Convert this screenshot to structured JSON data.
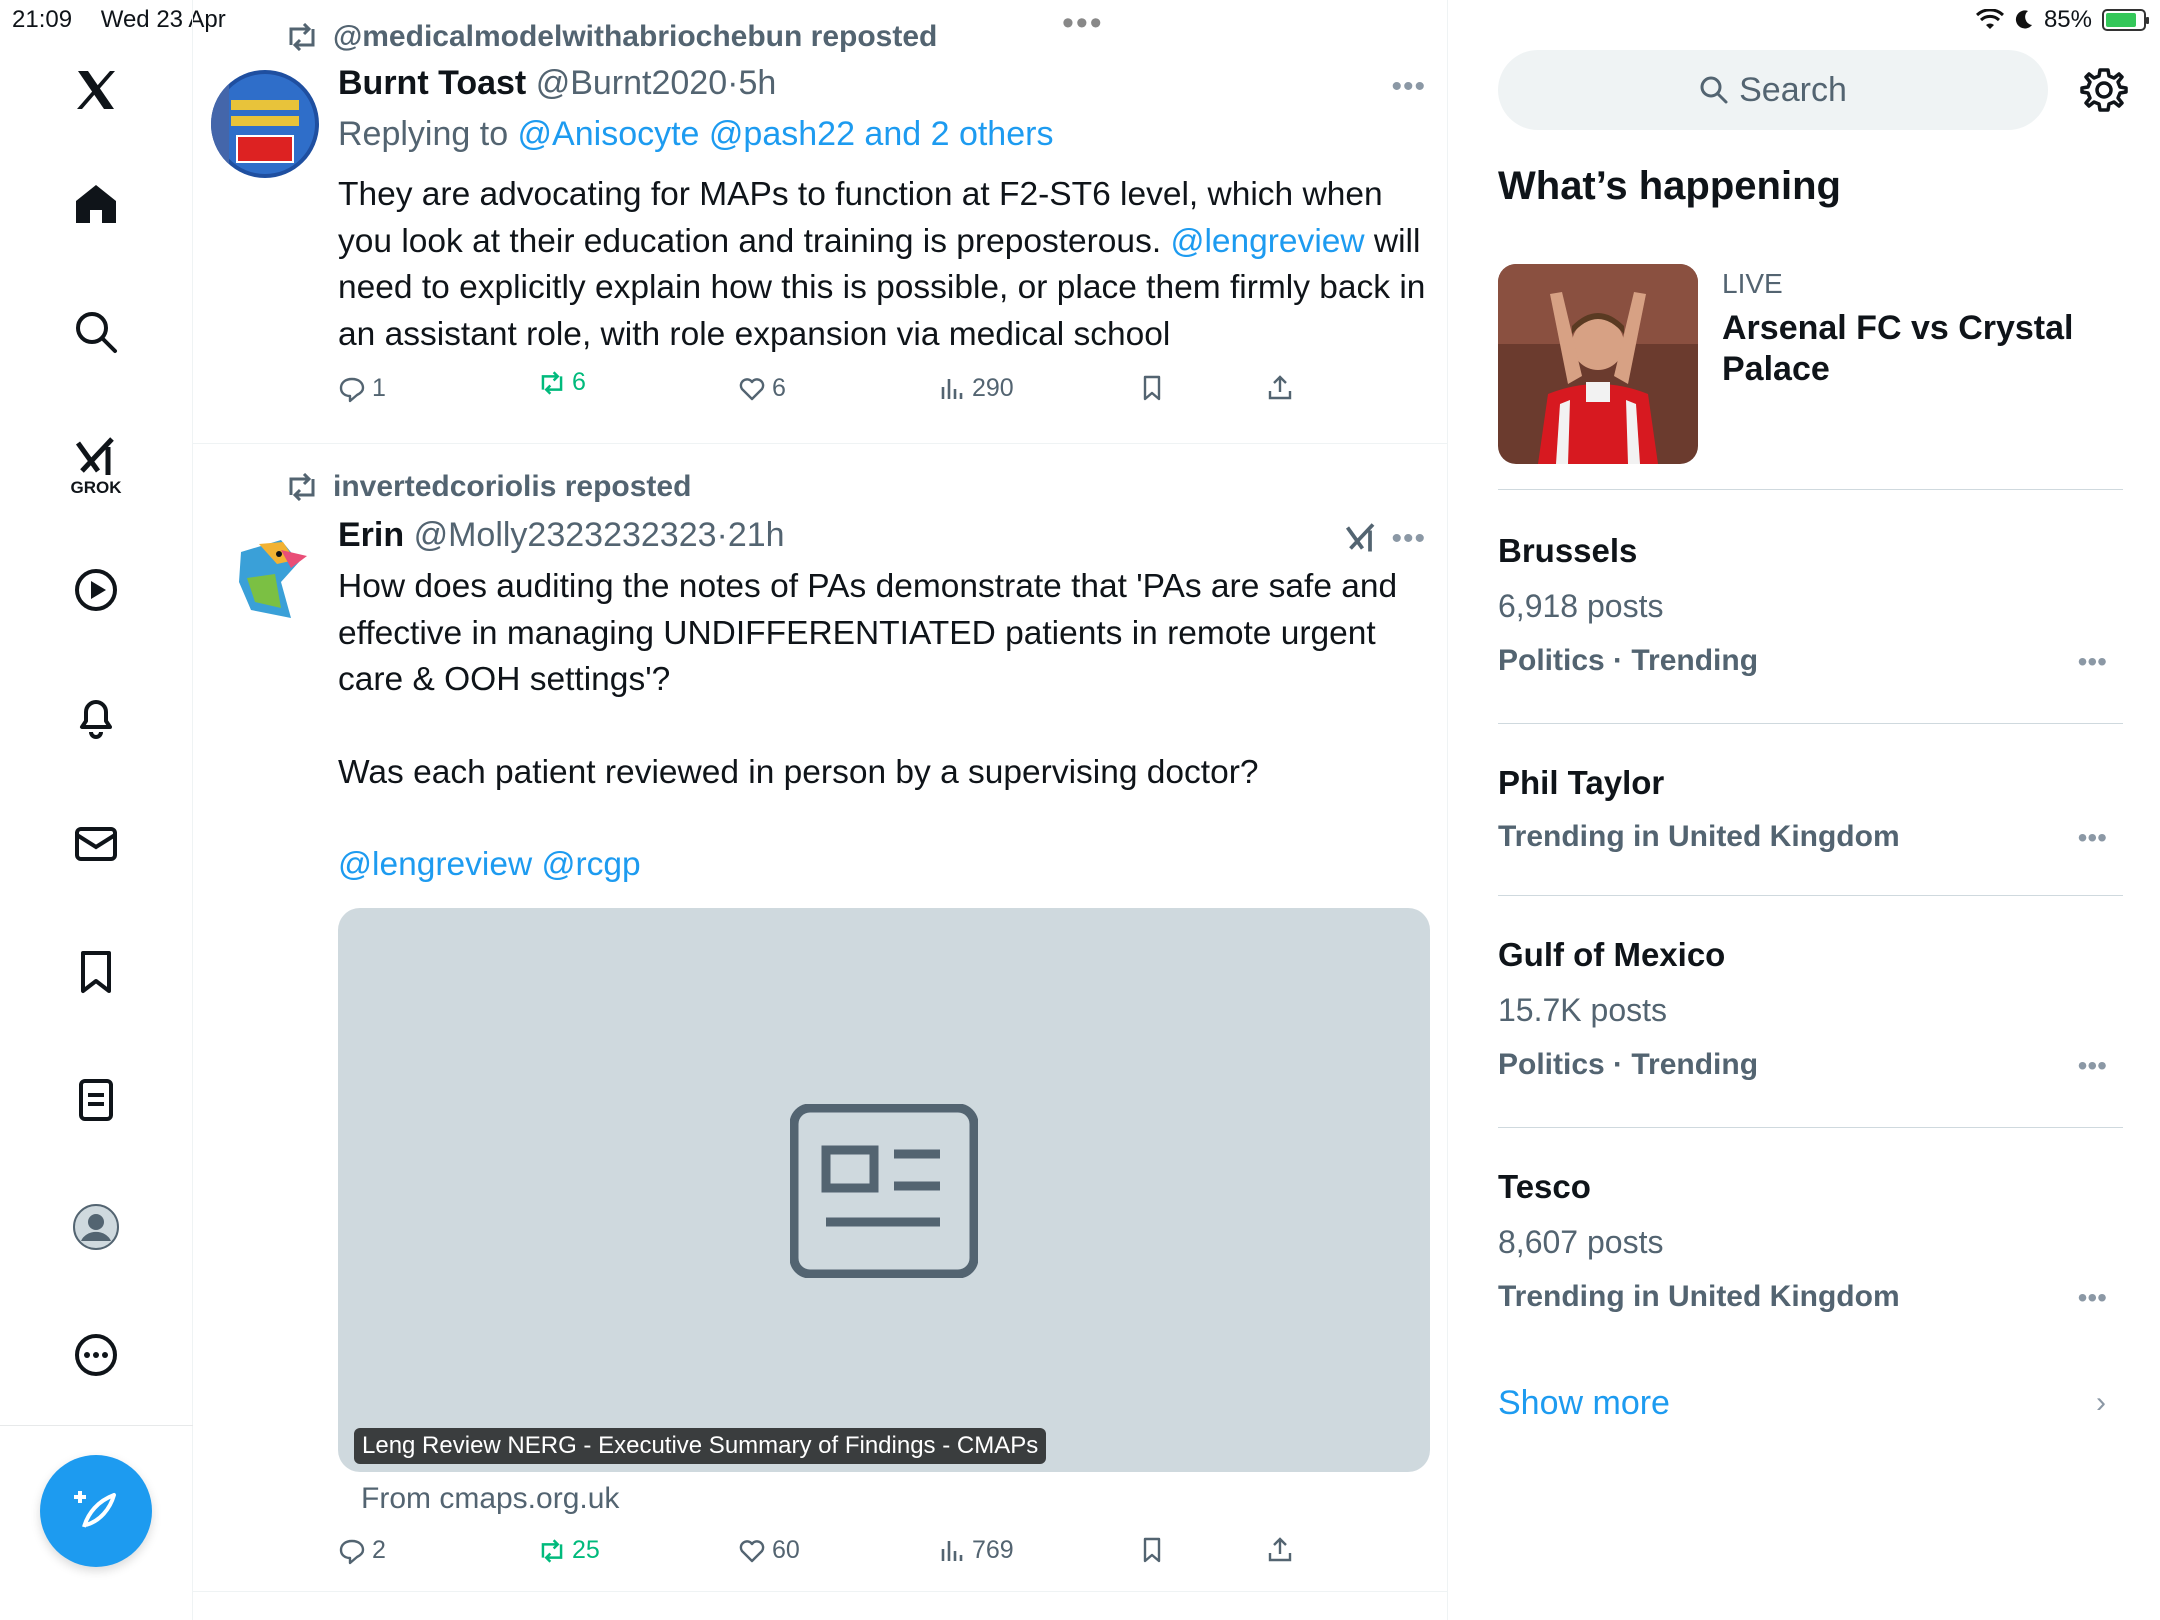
{
  "status_bar": {
    "time": "21:09",
    "date": "Wed 23 Apr",
    "battery": "85%"
  },
  "nav": {
    "grok_label": "GROK"
  },
  "posts": [
    {
      "reposted_by": "@medicalmodelwithabriochebun reposted",
      "name": "Burnt Toast",
      "handle": "@Burnt2020",
      "dot": "·",
      "time": "5h",
      "reply_prefix": "Replying to ",
      "reply_to": "@Anisocyte @pash22 and 2 others",
      "text_1": "They are advocating for MAPs to function at F2-ST6 level, which when you look at their education and training is preposterous. ",
      "mention": "@lengreview",
      "text_2": " will need to explicitly explain how this is possible, or place them firmly back in an assistant role, with role expansion via medical school",
      "replies": "1",
      "reposts": "6",
      "likes": "6",
      "views": "290"
    },
    {
      "reposted_by": "invertedcoriolis reposted",
      "name": "Erin",
      "handle": "@Molly2323232323",
      "dot": "·",
      "time": "21h",
      "para_1": "How does auditing the notes of PAs demonstrate that 'PAs are safe and effective in managing UNDIFFERENTIATED patients in remote urgent care & OOH settings'?",
      "para_2": "Was each patient reviewed in person by a supervising doctor?",
      "mentions": "@lengreview @rcgp",
      "card_caption": "Leng Review NERG - Executive Summary of Findings - CMAPs",
      "card_from": "From cmaps.org.uk",
      "replies": "2",
      "reposts": "25",
      "likes": "60",
      "views": "769"
    }
  ],
  "sidebar": {
    "search_placeholder": "Search",
    "section_title": "What’s happening",
    "live": {
      "tag": "LIVE",
      "title": "Arsenal FC vs Crystal Palace"
    },
    "trends": [
      {
        "name": "Brussels",
        "posts": "6,918 posts",
        "category": "Politics · Trending"
      },
      {
        "name": "Phil Taylor",
        "posts": "",
        "category": "Trending in United Kingdom"
      },
      {
        "name": "Gulf of Mexico",
        "posts": "15.7K posts",
        "category": "Politics · Trending"
      },
      {
        "name": "Tesco",
        "posts": "8,607 posts",
        "category": "Trending in United Kingdom"
      }
    ],
    "show_more": "Show more"
  },
  "colors": {
    "accent": "#1d9bf0",
    "repost_green": "#00ba7c",
    "muted": "#536471"
  },
  "icons": [
    "x-logo-icon",
    "home-icon",
    "search-icon",
    "grok-icon",
    "video-icon",
    "bell-icon",
    "mail-icon",
    "bookmark-icon",
    "lists-icon",
    "profile-icon",
    "more-icon",
    "compose-icon",
    "gear-icon",
    "reply-icon",
    "repost-icon",
    "like-icon",
    "views-icon",
    "share-icon",
    "article-icon"
  ]
}
